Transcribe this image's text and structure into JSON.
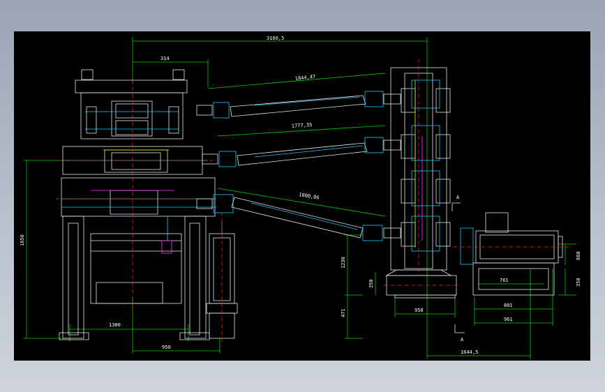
{
  "drawing": {
    "dims": {
      "top_overall": "3160,5",
      "top_short": "314",
      "shaft_upper": "1844,47",
      "shaft_middle": "1777,35",
      "shaft_lower": "1800,06",
      "left_height": "1650",
      "left_base": "1380",
      "bottom_span": "950",
      "vert_mid": "1230",
      "vert_low": "471",
      "base_h": "350",
      "base_w": "950",
      "right_total": "1644,5",
      "motor_w1": "761",
      "motor_w2": "801",
      "motor_w3": "961",
      "motor_h1": "860",
      "motor_h2": "350"
    },
    "section_marks": [
      "A",
      "A"
    ]
  },
  "colors": {
    "background": "#000000",
    "dimension": "#00d000",
    "outline": "#e8e8e8",
    "hidden": "#18c8ff",
    "centerline": "#ff2a2a",
    "accent_yellow": "#e6e600",
    "accent_magenta": "#ff40ff"
  }
}
